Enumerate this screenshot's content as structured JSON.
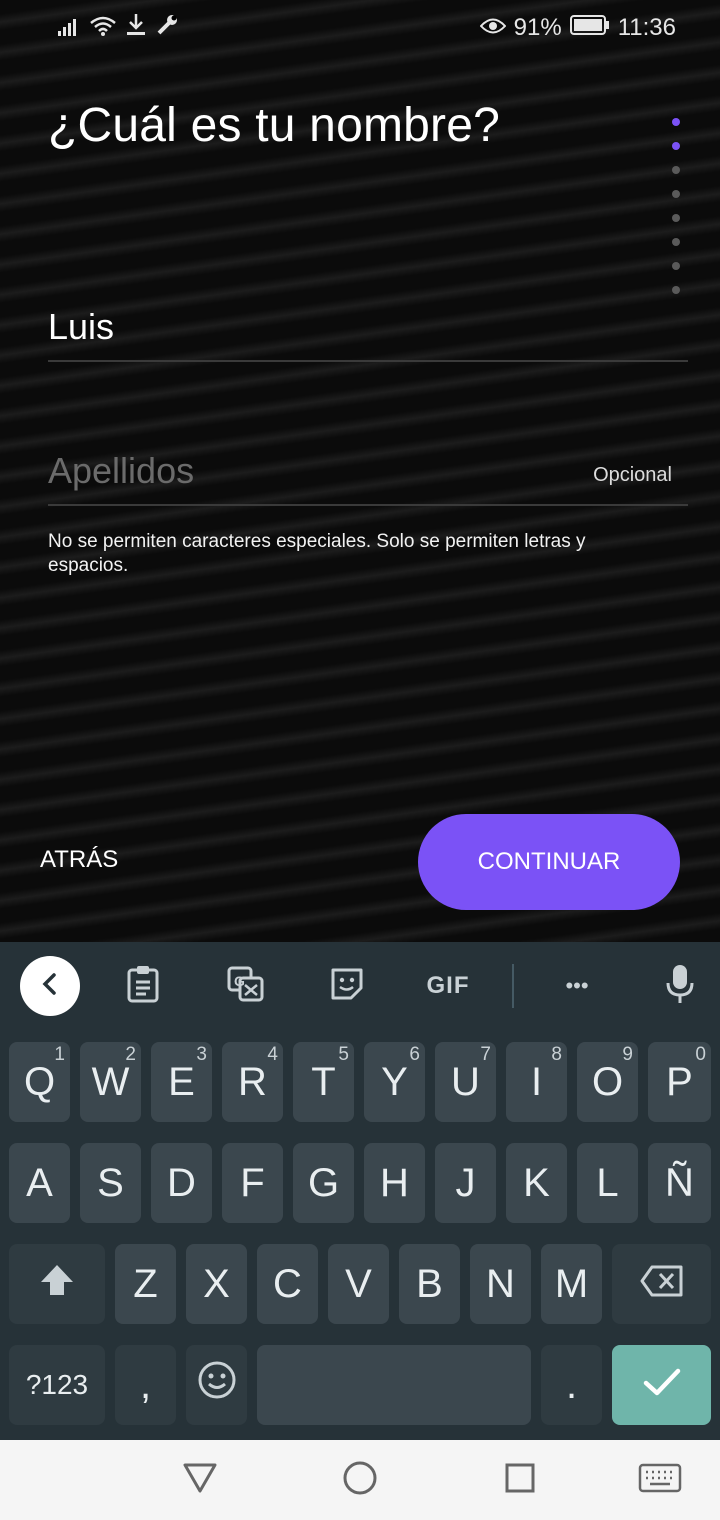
{
  "status_bar": {
    "battery": "91%",
    "time": "11:36"
  },
  "screen": {
    "title": "¿Cuál es tu nombre?",
    "progress_total": 8,
    "progress_active": 2,
    "first_name_value": "Luis",
    "last_name_placeholder": "Apellidos",
    "last_name_optional_label": "Opcional",
    "hint": "No se permiten caracteres especiales. Solo se permiten letras y espacios.",
    "back_label": "ATRÁS",
    "continue_label": "CONTINUAR",
    "accent_color": "#7b52f6"
  },
  "keyboard": {
    "toolbar": {
      "gif_label": "GIF",
      "more_label": "•••"
    },
    "row1": [
      {
        "label": "Q",
        "hint": "1"
      },
      {
        "label": "W",
        "hint": "2"
      },
      {
        "label": "E",
        "hint": "3"
      },
      {
        "label": "R",
        "hint": "4"
      },
      {
        "label": "T",
        "hint": "5"
      },
      {
        "label": "Y",
        "hint": "6"
      },
      {
        "label": "U",
        "hint": "7"
      },
      {
        "label": "I",
        "hint": "8"
      },
      {
        "label": "O",
        "hint": "9"
      },
      {
        "label": "P",
        "hint": "0"
      }
    ],
    "row2": [
      "A",
      "S",
      "D",
      "F",
      "G",
      "H",
      "J",
      "K",
      "L",
      "Ñ"
    ],
    "row3": [
      "Z",
      "X",
      "C",
      "V",
      "B",
      "N",
      "M"
    ],
    "symbols_label": "?123",
    "comma_label": ",",
    "period_label": ".",
    "enter_color": "#6fb5aa"
  }
}
